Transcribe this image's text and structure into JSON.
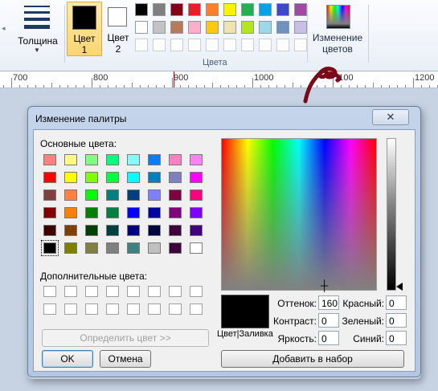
{
  "ribbon": {
    "thickness_label": "Толщина",
    "color1_label": "Цвет 1",
    "color1_line1": "Цвет",
    "color1_line2": "1",
    "color2_line1": "Цвет",
    "color2_line2": "2",
    "color1_value": "#000000",
    "color2_value": "#ffffff",
    "palette_row1": [
      "#000000",
      "#7f7f7f",
      "#880015",
      "#ed1c24",
      "#ff7f27",
      "#fff200",
      "#22b14c",
      "#00a2e8",
      "#3f48cc",
      "#a349a4"
    ],
    "palette_row2": [
      "#ffffff",
      "#c3c3c3",
      "#b97a57",
      "#ffaec9",
      "#ffc90e",
      "#efe4b0",
      "#b5e61d",
      "#99d9ea",
      "#7092be",
      "#c8bfe7"
    ],
    "palette_row3": [
      "#ffffff",
      "#ffffff",
      "#ffffff",
      "#ffffff",
      "#ffffff",
      "#ffffff",
      "#ffffff",
      "#ffffff",
      "#ffffff",
      "#ffffff"
    ],
    "colors_group_label": "Цвета",
    "edit_colors_line1": "Изменение",
    "edit_colors_line2": "цветов"
  },
  "ruler": {
    "labels": [
      "700",
      "800",
      "900",
      "1000",
      "1100",
      "1200"
    ]
  },
  "dialog": {
    "title": "Изменение палитры",
    "close_glyph": "✕",
    "basic_colors_label": "Основные цвета:",
    "basic_colors": [
      [
        "#ff8080",
        "#ffff80",
        "#80ff80",
        "#00ff80",
        "#80ffff",
        "#0080ff",
        "#ff80c0",
        "#ff80ff"
      ],
      [
        "#ff0000",
        "#ffff00",
        "#80ff00",
        "#00ff40",
        "#00ffff",
        "#0080c0",
        "#8080c0",
        "#ff00ff"
      ],
      [
        "#804040",
        "#ff8040",
        "#00ff00",
        "#008080",
        "#004080",
        "#8080ff",
        "#800040",
        "#ff0080"
      ],
      [
        "#800000",
        "#ff8000",
        "#008000",
        "#008040",
        "#0000ff",
        "#0000a0",
        "#800080",
        "#8000ff"
      ],
      [
        "#400000",
        "#804000",
        "#004000",
        "#004040",
        "#000080",
        "#000040",
        "#400040",
        "#400080"
      ],
      [
        "#000000",
        "#808000",
        "#808040",
        "#808080",
        "#408080",
        "#c0c0c0",
        "#400040",
        "#ffffff"
      ]
    ],
    "custom_colors_label": "Дополнительные цвета:",
    "define_button": "Определить цвет >>",
    "ok_button": "OK",
    "cancel_button": "Отмена",
    "preview_label": "Цвет|Заливка",
    "preview_color": "#000000",
    "hue_label": "Оттенок:",
    "hue_value": "160",
    "sat_label": "Контраст:",
    "sat_value": "0",
    "lum_label": "Яркость:",
    "lum_value": "0",
    "red_label": "Красный:",
    "red_value": "0",
    "green_label": "Зеленый:",
    "green_value": "0",
    "blue_label": "Синий:",
    "blue_value": "0",
    "add_button": "Добавить в набор"
  }
}
